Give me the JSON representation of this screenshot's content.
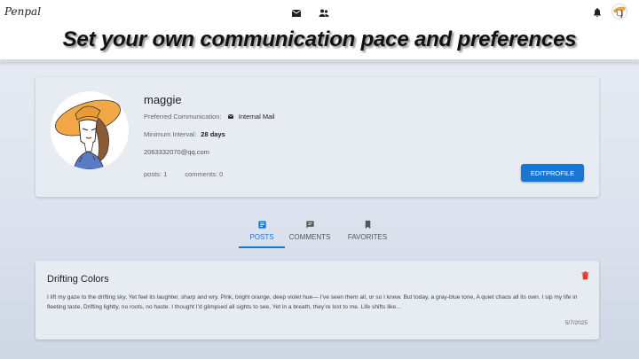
{
  "nav": {
    "brand": "Penpal",
    "icons": [
      "mail-icon",
      "people-icon",
      "bell-icon",
      "avatar"
    ]
  },
  "banner": {
    "text": "Set your own communication pace and preferences"
  },
  "profile": {
    "username": "maggie",
    "preferred_label": "Preferred Communication:",
    "preferred_value": "Internal Mail",
    "interval_label": "Minimum Interval:",
    "interval_value": "28 days",
    "email": "2063332070@qq.com",
    "posts_count": "posts: 1",
    "comments_count": "comments: 0",
    "edit_button": "EDITPROFILE"
  },
  "tabs": [
    {
      "label": "POSTS",
      "icon": "article-icon",
      "active": true
    },
    {
      "label": "COMMENTS",
      "icon": "comment-icon",
      "active": false
    },
    {
      "label": "FAVORITES",
      "icon": "bookmark-icon",
      "active": false
    }
  ],
  "post": {
    "title": "Drifting Colors",
    "body": "I lift my gaze to the drifting sky, Yet feel its laughter, sharp and wry. Pink, bright orange, deep violet hue— I’ve seen them all, or so I knew. But today, a gray-blue tone, A quiet chaos all its own. I sip my life in fleeting taste, Drifting lightly, no roots, no haste. I thought I’d glimpsed all sights to see, Yet in a breath, they’re lost to me. Life shifts like...",
    "date": "5/7/2025"
  },
  "colors": {
    "accent": "#1976d2",
    "delete": "#e53935",
    "card": "#e7ebf2"
  }
}
